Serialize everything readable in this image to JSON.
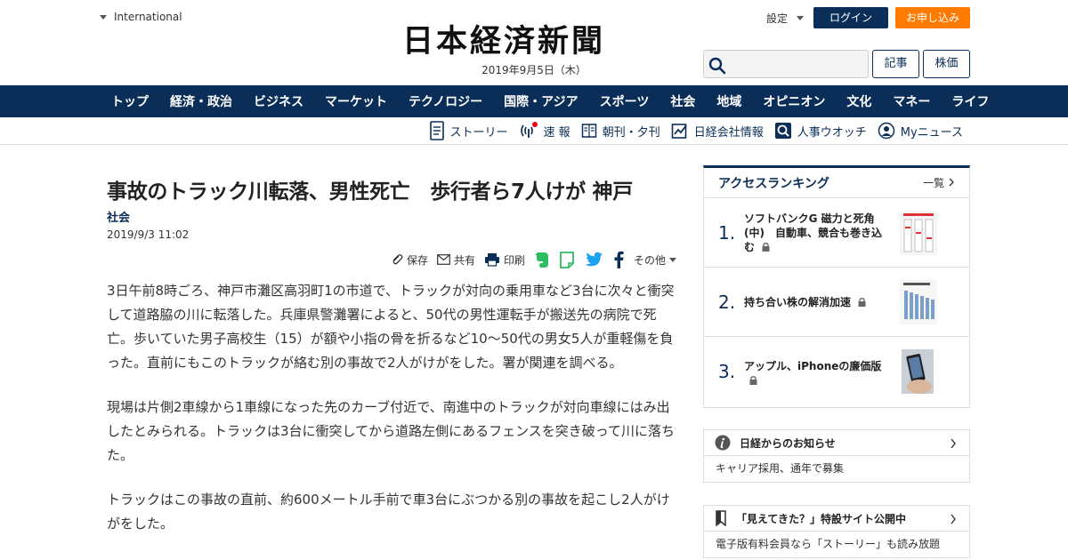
{
  "header": {
    "region": "International",
    "logo": "日本経済新聞",
    "date": "2019年9月5日（木）",
    "settings": "設定",
    "login": "ログイン",
    "subscribe": "お申し込み",
    "search_placeholder": "",
    "article_button": "記事",
    "stock_button": "株価"
  },
  "nav": [
    "トップ",
    "経済・政治",
    "ビジネス",
    "マーケット",
    "テクノロジー",
    "国際・アジア",
    "スポーツ",
    "社会",
    "地域",
    "オピニオン",
    "文化",
    "マネー",
    "ライフ"
  ],
  "subnav": [
    {
      "label": "ストーリー",
      "icon": "story-icon"
    },
    {
      "label": "速 報",
      "icon": "breaking-news-icon"
    },
    {
      "label": "朝刊・夕刊",
      "icon": "newspaper-icon"
    },
    {
      "label": "日経会社情報",
      "icon": "company-info-icon"
    },
    {
      "label": "人事ウオッチ",
      "icon": "personnel-watch-icon"
    },
    {
      "label": "Myニュース",
      "icon": "my-news-icon"
    }
  ],
  "article": {
    "title": "事故のトラック川転落、男性死亡　歩行者ら7人けが 神戸",
    "category": "社会",
    "timestamp": "2019/9/3 11:02",
    "tools": {
      "save": "保存",
      "share": "共有",
      "print": "印刷",
      "more": "その他"
    },
    "paragraphs": [
      "3日午前8時ごろ、神戸市灘区高羽町1の市道で、トラックが対向の乗用車など3台に次々と衝突して道路脇の川に転落した。兵庫県警灘署によると、50代の男性運転手が搬送先の病院で死亡。歩いていた男子高校生（15）が額や小指の骨を折るなど10～50代の男女5人が重軽傷を負った。直前にもこのトラックが絡む別の事故で2人がけがをした。署が関連を調べる。",
      "現場は片側2車線から1車線になった先のカーブ付近で、南進中のトラックが対向車線にはみ出したとみられる。トラックは3台に衝突してから道路左側にあるフェンスを突き破って川に落ちた。",
      "トラックはこの事故の直前、約600メートル手前で車3台にぶつかる別の事故を起こし2人がけがをした。"
    ]
  },
  "ranking": {
    "title": "アクセスランキング",
    "all_label": "一覧",
    "items": [
      {
        "num": "1.",
        "text": "ソフトバンクG 磁力と死角(中)　自動車、競合も巻き込む"
      },
      {
        "num": "2.",
        "text": "持ち合い株の解消加速"
      },
      {
        "num": "3.",
        "text": "アップル、iPhoneの廉価版"
      }
    ]
  },
  "notices": [
    {
      "title": "日経からのお知らせ",
      "body": "キャリア採用、通年で募集",
      "icon": "info-icon"
    },
    {
      "title": "「見えてきた？」特設サイト公開中",
      "body": "電子版有料会員なら「ストーリー」も読み放題",
      "icon": "bookmark-icon"
    }
  ],
  "colors": {
    "brand_navy": "#0a2e57",
    "subscribe_orange": "#ff7a00",
    "evernote_green": "#2dbe60",
    "twitter_blue": "#1da1f2"
  }
}
